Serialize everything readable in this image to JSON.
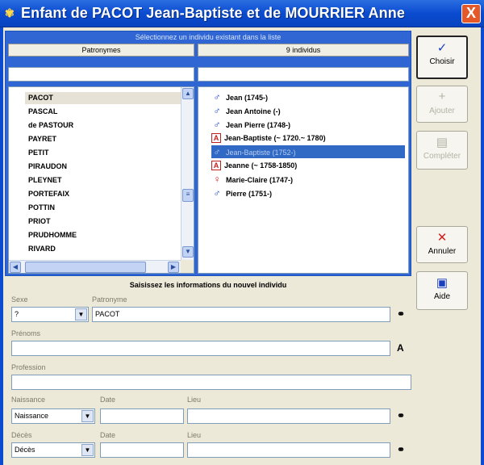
{
  "window": {
    "title": "Enfant de PACOT Jean-Baptiste et de MOURRIER Anne",
    "close_label": "X",
    "app_icon": "genealogy-app-icon"
  },
  "select_panel": {
    "header": "Sélectionnez un individu existant dans la liste",
    "patronymes_header": "Patronymes",
    "individus_header": "9 individus",
    "patronymes": [
      "PACOT",
      "PASCAL",
      "de PASTOUR",
      "PAYRET",
      "PETIT",
      "PIRAUDON",
      "PLEYNET",
      "PORTEFAIX",
      "POTTIN",
      "PRIOT",
      "PRUDHOMME",
      "RIVARD"
    ],
    "selected_patronyme": "PACOT",
    "individus": [
      {
        "sex": "m",
        "label": "Jean (1745-)"
      },
      {
        "sex": "m",
        "label": "Jean Antoine (-)"
      },
      {
        "sex": "m",
        "label": "Jean Pierre (1748-)"
      },
      {
        "sex": "u",
        "label": "Jean-Baptiste (~ 1720.~ 1780)"
      },
      {
        "sex": "m",
        "label": "Jean-Baptiste (1752-)"
      },
      {
        "sex": "u",
        "label": "Jeanne (~ 1758-1850)"
      },
      {
        "sex": "f",
        "label": "Marie-Claire (1747-)"
      },
      {
        "sex": "m",
        "label": "Pierre (1751-)"
      }
    ],
    "selected_index": 4
  },
  "buttons": {
    "choisir": "Choisir",
    "ajouter": "Ajouter",
    "completer": "Compléter",
    "annuler": "Annuler",
    "aide": "Aide"
  },
  "new_person": {
    "header": "Saisissez les informations du nouvel individu",
    "sexe_label": "Sexe",
    "sexe_value": "?",
    "patronyme_label": "Patronyme",
    "patronyme_value": "PACOT",
    "prenoms_label": "Prénoms",
    "prenoms_value": "",
    "profession_label": "Profession",
    "profession_value": "",
    "naissance_label": "Naissance",
    "naissance_value": "Naissance",
    "date1_label": "Date",
    "lieu1_label": "Lieu",
    "deces_label": "Décès",
    "deces_value": "Décès",
    "date2_label": "Date",
    "lieu2_label": "Lieu"
  },
  "colors": {
    "title_bar": "#0a4bd0",
    "selection": "#316ac5",
    "close": "#e4582a"
  }
}
